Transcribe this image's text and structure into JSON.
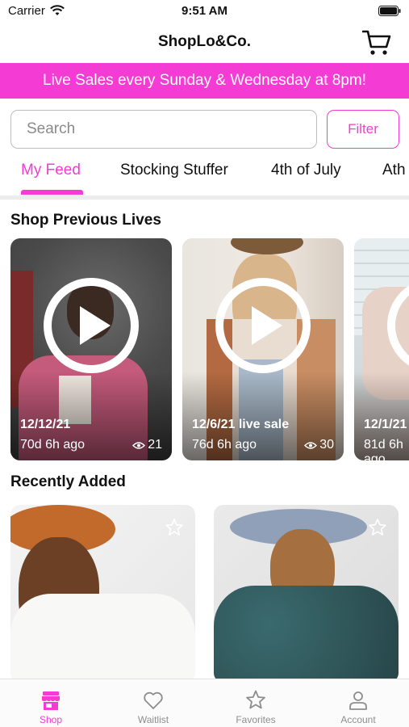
{
  "status_bar": {
    "carrier": "Carrier",
    "time": "9:51 AM"
  },
  "header": {
    "title": "ShopLo&Co."
  },
  "banner": {
    "text": "Live Sales every Sunday & Wednesday at 8pm!"
  },
  "search": {
    "placeholder": "Search",
    "value": ""
  },
  "filter": {
    "label": "Filter"
  },
  "tabs": [
    {
      "label": "My Feed",
      "active": true
    },
    {
      "label": "Stocking Stuffer",
      "active": false
    },
    {
      "label": "4th of July",
      "active": false
    },
    {
      "label": "Ath",
      "active": false
    }
  ],
  "sections": {
    "previous_lives": "Shop Previous Lives",
    "recently_added": "Recently Added"
  },
  "lives": [
    {
      "date": "12/12/21",
      "ago": "70d 6h ago",
      "views": "21"
    },
    {
      "date": "12/6/21 live sale",
      "ago": "76d 6h ago",
      "views": "30"
    },
    {
      "date": "12/1/21",
      "ago": "81d 6h ago",
      "views": ""
    }
  ],
  "bottom_tabs": [
    {
      "label": "Shop",
      "icon": "storefront-icon",
      "active": true
    },
    {
      "label": "Waitlist",
      "icon": "heart-icon",
      "active": false
    },
    {
      "label": "Favorites",
      "icon": "star-icon",
      "active": false
    },
    {
      "label": "Account",
      "icon": "person-icon",
      "active": false
    }
  ],
  "colors": {
    "accent": "#f43bd3",
    "banner_bg": "#f43bd3",
    "inactive": "#8e8e8e"
  }
}
